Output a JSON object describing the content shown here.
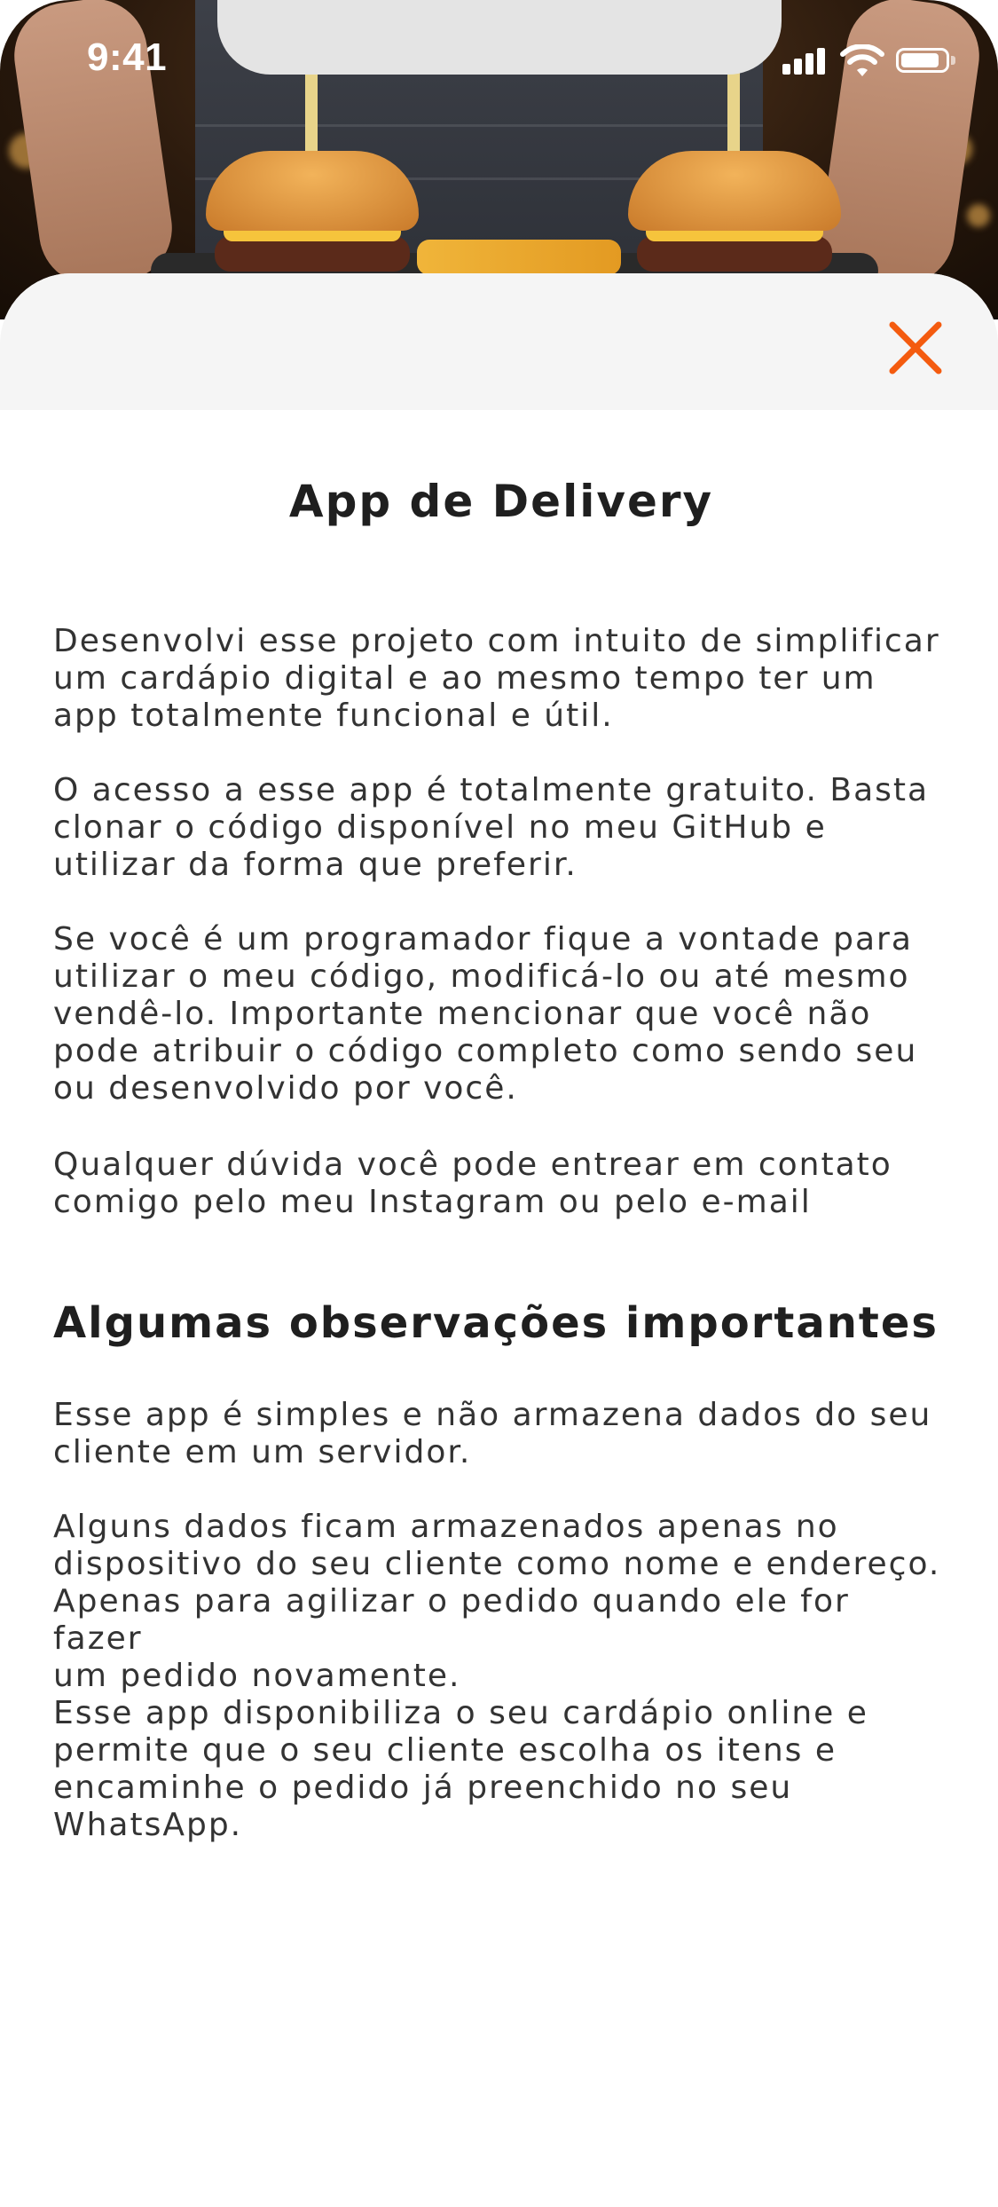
{
  "status_bar": {
    "time": "9:41"
  },
  "colors": {
    "accent": "#F45B0F",
    "sheet_header_bg": "#F5F5F5",
    "text": "#333333",
    "heading": "#1F1F1F"
  },
  "hero": {
    "image": "burgers-photo"
  },
  "modal": {
    "close_icon": "close-icon",
    "title": "App de Delivery",
    "paragraphs": [
      "Desenvolvi esse projeto com intuito de simplificar\num cardápio digital e ao mesmo tempo ter um\napp totalmente funcional e útil.",
      "O acesso a esse app é totalmente gratuito.  Basta\nclonar o código disponível no meu GitHub e\nutilizar da forma que preferir.",
      "Se você é um programador fique a vontade para\nutilizar o meu código, modificá-lo ou até mesmo\nvendê-lo. Importante mencionar que você não\npode atribuir o código completo como sendo seu\nou desenvolvido por você.",
      "Qualquer dúvida você pode entrear em contato\ncomigo pelo meu Instagram ou pelo e-mail"
    ],
    "subtitle": "Algumas observações importantes",
    "notes": [
      "Esse app é simples e não armazena dados do seu\ncliente em um servidor.",
      "Alguns dados ficam armazenados apenas no\ndispositivo do seu cliente como nome e endereço.\nApenas para agilizar o pedido quando ele for fazer\num pedido novamente.",
      "Esse app disponibiliza o seu cardápio online e\npermite que o seu cliente escolha os itens e\nencaminhe o pedido já preenchido no seu\nWhatsApp."
    ]
  }
}
